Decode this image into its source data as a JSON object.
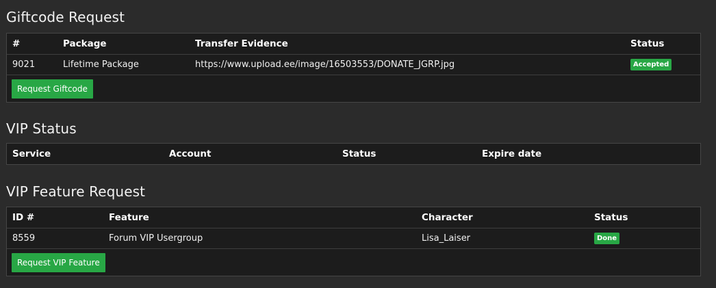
{
  "giftcode": {
    "title": "Giftcode Request",
    "headers": [
      "#",
      "Package",
      "Transfer Evidence",
      "Status"
    ],
    "rows": [
      {
        "id": "9021",
        "package": "Lifetime Package",
        "evidence": "https://www.upload.ee/image/16503553/DONATE_JGRP.jpg",
        "status": "Accepted"
      }
    ],
    "button_label": "Request Giftcode"
  },
  "vip_status": {
    "title": "VIP Status",
    "headers": [
      "Service",
      "Account",
      "Status",
      "Expire date"
    ]
  },
  "vip_feature": {
    "title": "VIP Feature Request",
    "headers": [
      "ID #",
      "Feature",
      "Character",
      "Status"
    ],
    "rows": [
      {
        "id": "8559",
        "feature": "Forum VIP Usergroup",
        "character": "Lisa_Laiser",
        "status": "Done"
      }
    ],
    "button_label": "Request VIP Feature"
  },
  "colors": {
    "background": "#2b2b2b",
    "panel": "#1c1c1c",
    "success": "#28a745"
  }
}
